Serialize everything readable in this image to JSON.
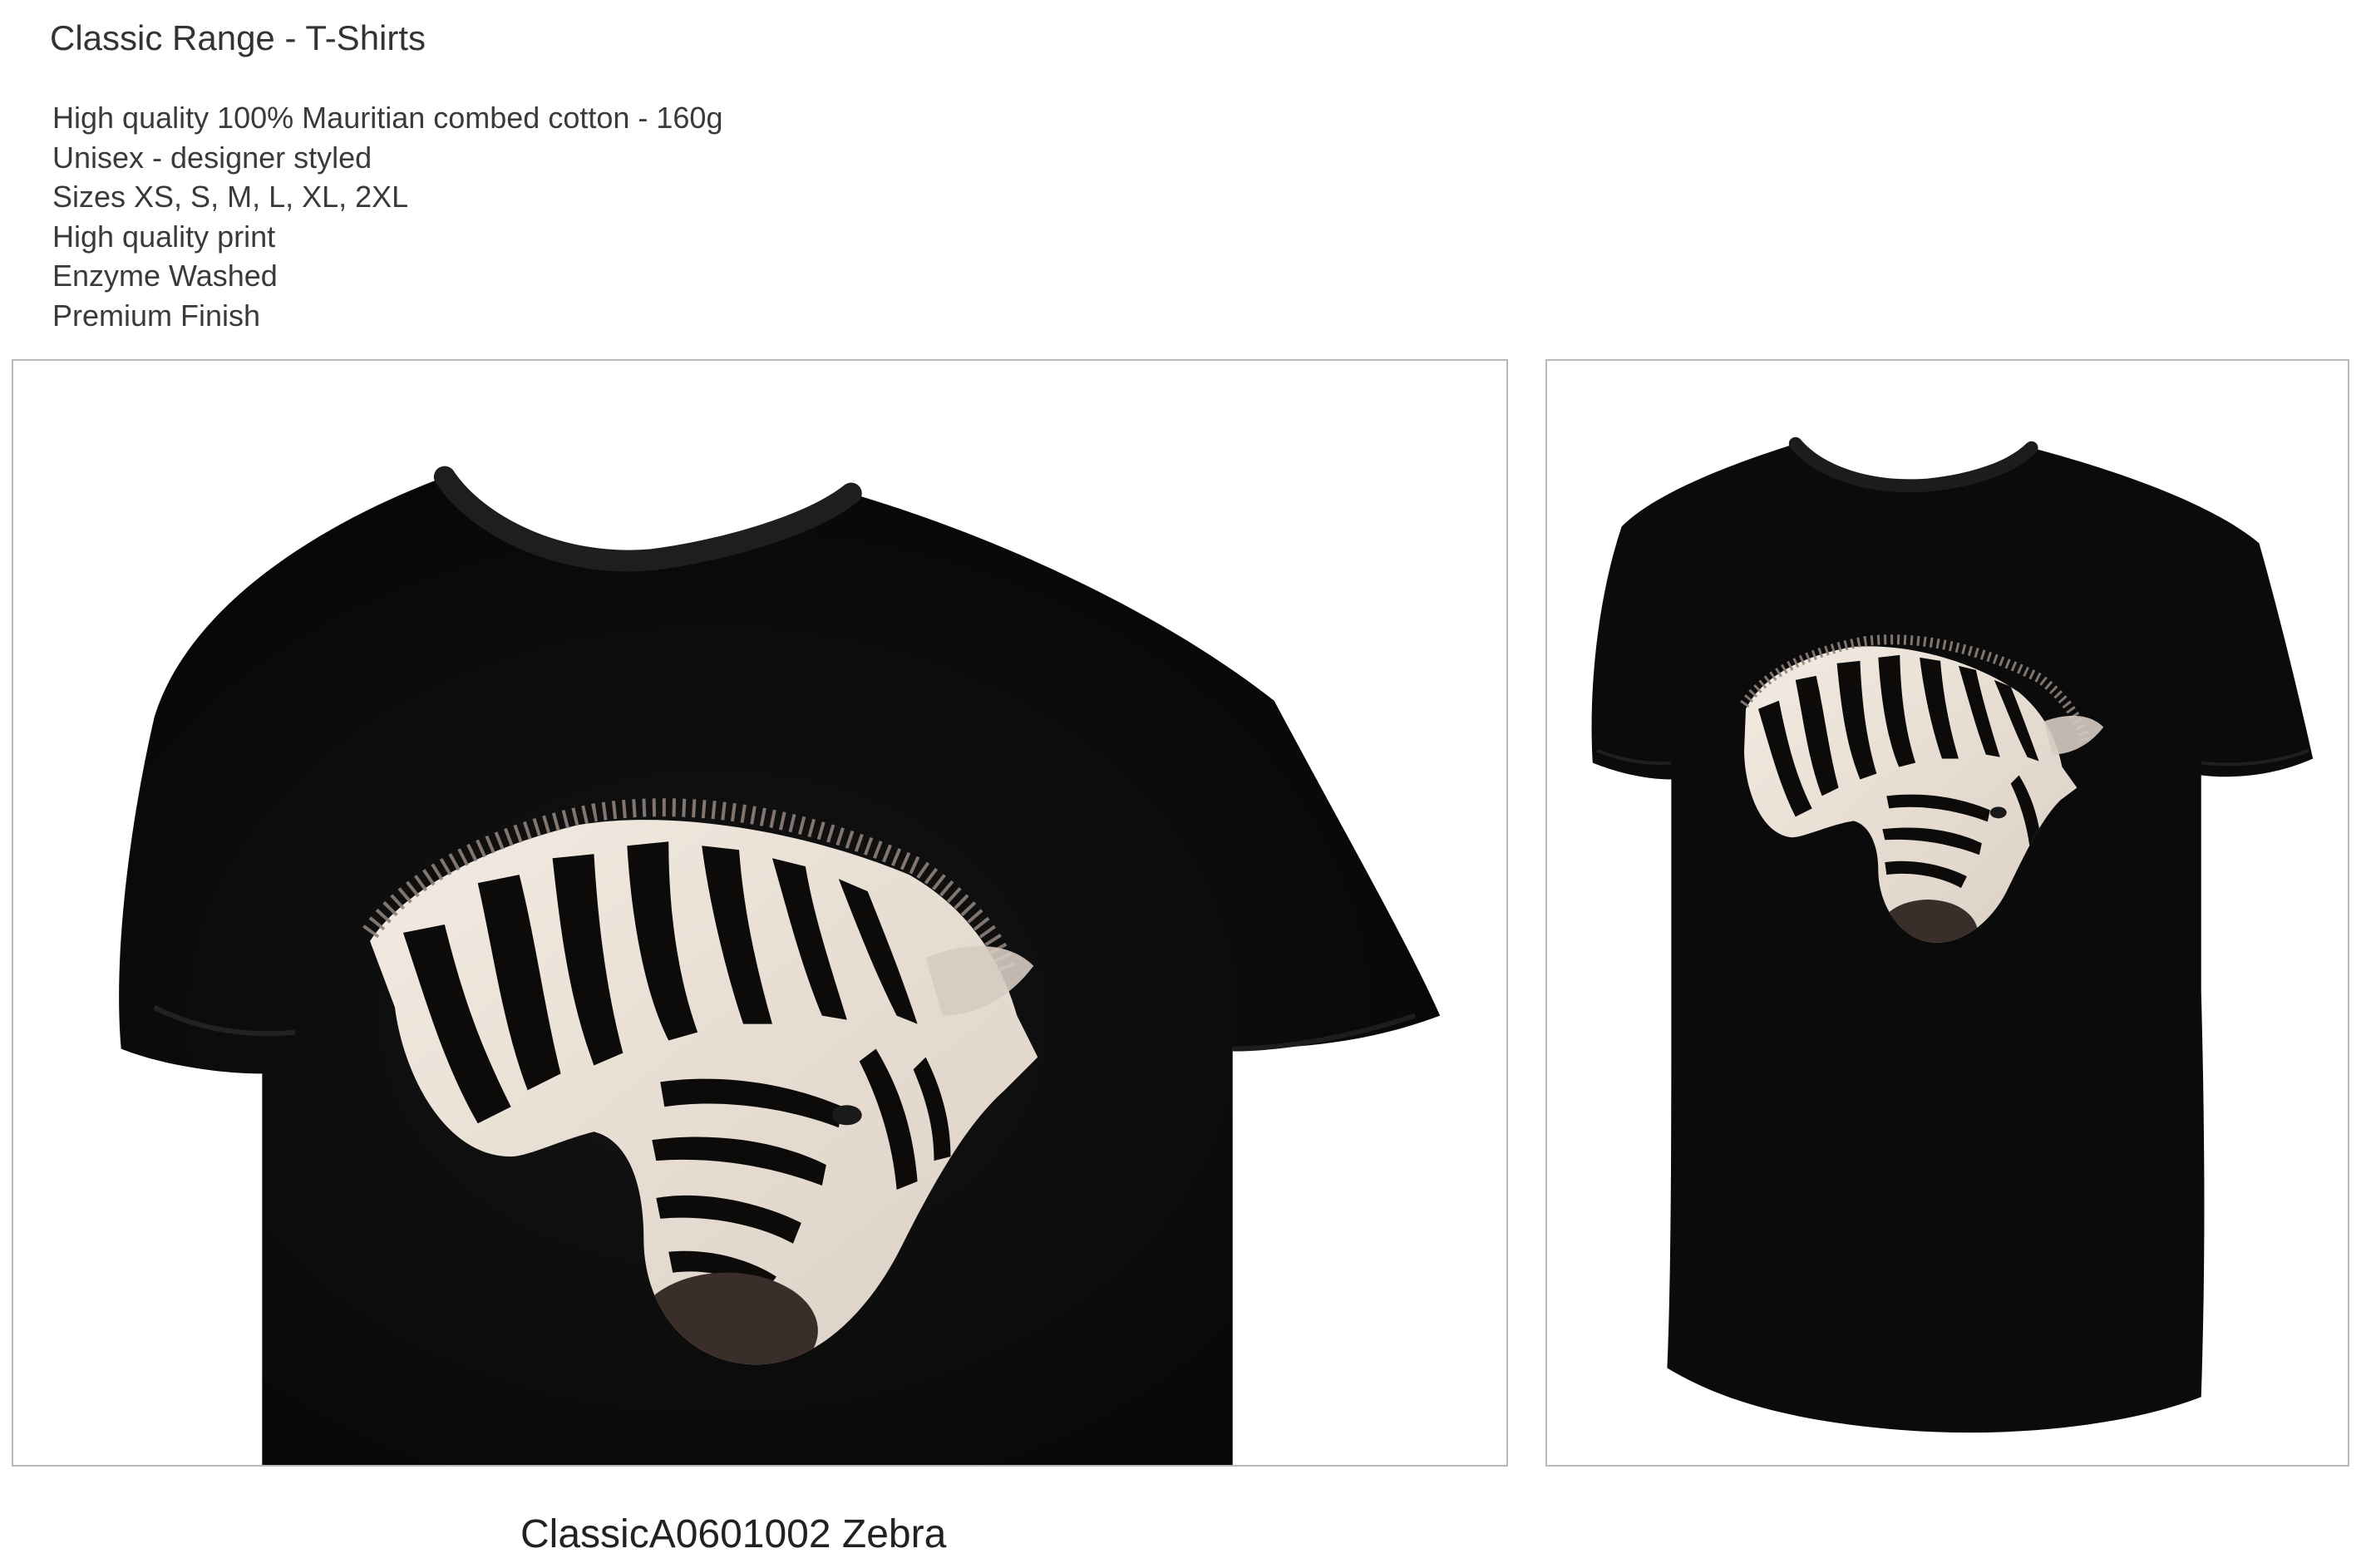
{
  "page": {
    "title": "Classic Range - T-Shirts",
    "features": [
      "High quality 100% Mauritian combed cotton - 160g",
      "Unisex - designer styled",
      "Sizes XS, S, M, L, XL, 2XL",
      "High quality print",
      "Enzyme Washed",
      "Premium Finish"
    ],
    "caption": "ClassicA0601002 Zebra"
  },
  "product_images": [
    {
      "view": "close-up",
      "subject": "black t-shirt with zebra head print"
    },
    {
      "view": "full",
      "subject": "black t-shirt with zebra head print"
    }
  ],
  "colors": {
    "shirt": "#0c0c0c",
    "frame_border": "#b8b8b8",
    "zebra_light": "#efe6dc",
    "text": "#3a3a3a"
  }
}
